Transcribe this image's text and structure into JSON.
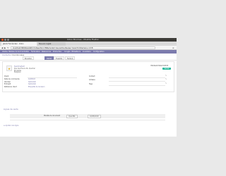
{
  "window": {
    "title": "Odoo Brumes - Mozilla Firefox",
    "controls": [
      "close",
      "minimize",
      "maximize"
    ]
  },
  "browser": {
    "tabs": [
      {
        "label": "Jakob Fernández - Odoo"
      },
      {
        "label": "Nouvel onglet"
      }
    ],
    "url": "localhost:8069/web#id=14&action=89&model=res.partner&view_type=form&menu_id=8"
  },
  "odoo_menu": {
    "items": [
      "Ventes",
      "Tableau de bord",
      "Activités",
      "Facturation",
      "Ressources",
      "Production",
      "Congés",
      "Utilisateurs",
      "Inventaire",
      "Configuration"
    ]
  },
  "breadcrumb": {
    "parent": "Contacts",
    "current": "/ Coordonnées"
  },
  "statusbar": {
    "items": [
      {
        "label": "Brouillon",
        "active": false
      },
      {
        "label": "Validé",
        "active": true
      },
      {
        "label": "Expédié",
        "active": false
      },
      {
        "label": "Facturé",
        "active": false
      }
    ]
  },
  "partner": {
    "name": "testinstall",
    "address_line1": "Rue des Fleurs 26, Quartier",
    "address_line2": "Bruxelles",
    "address_line3": "Belgique"
  },
  "header_right": {
    "label": "Montant total",
    "value": "0,00 €",
    "button": "Valider"
  },
  "fields_left": [
    {
      "label": "Client",
      "value": ""
    },
    {
      "label": "Date de commande",
      "value": "10/05/18"
    },
    {
      "label": "Vendeur",
      "value": "testinstall"
    },
    {
      "label": "Entrepôt",
      "value": "testinstall"
    },
    {
      "label": "Référence client",
      "value": "Etiquette de livraison"
    }
  ],
  "fields_right": [
    {
      "label": "Contact",
      "value": ""
    },
    {
      "label": "Adresse",
      "value": ""
    },
    {
      "label": "Tags",
      "value": ""
    }
  ],
  "section": {
    "title": "Lignes de vente",
    "row": {
      "col1": "Modèle de document",
      "col2": "Quantité",
      "col3": "10/05/2018"
    }
  },
  "link": {
    "label": "Ajouter une ligne"
  }
}
